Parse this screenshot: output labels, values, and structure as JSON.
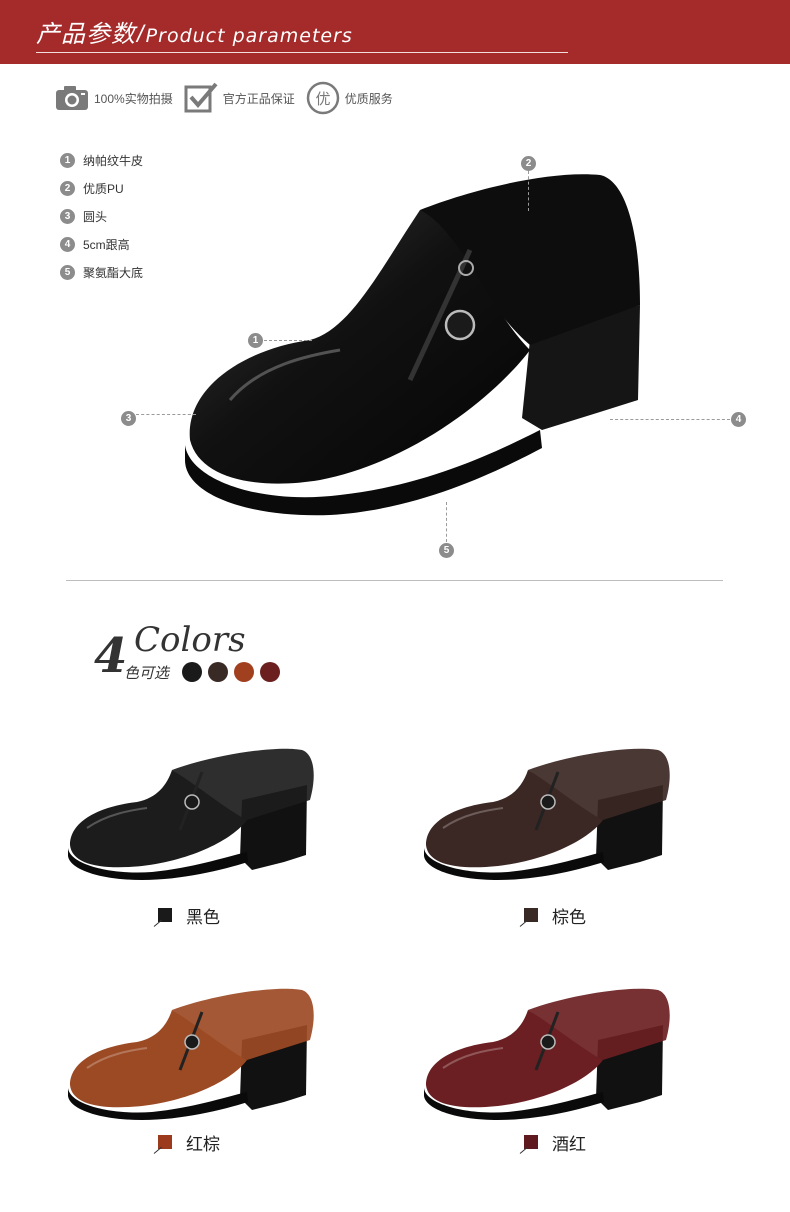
{
  "header": {
    "title_cn": "产品参数",
    "title_sep": "/",
    "title_en": "Product parameters"
  },
  "badges": [
    {
      "icon": "camera-icon",
      "label": "100%实物拍摄"
    },
    {
      "icon": "checkmark-icon",
      "label": "官方正品保证"
    },
    {
      "icon": "you-quality-icon",
      "icon_text": "优",
      "label": "优质服务"
    }
  ],
  "features": [
    {
      "num": "1",
      "label": "纳帕纹牛皮"
    },
    {
      "num": "2",
      "label": "优质PU"
    },
    {
      "num": "3",
      "label": "圆头"
    },
    {
      "num": "4",
      "label": "5cm跟高"
    },
    {
      "num": "5",
      "label": "聚氨酯大底"
    }
  ],
  "callouts": [
    "1",
    "2",
    "3",
    "4",
    "5"
  ],
  "colors_section": {
    "count": "4",
    "word": "Colors",
    "cn": "色可选",
    "swatches": [
      "#1a1a1a",
      "#3a2a26",
      "#a0401f",
      "#6b1f1f"
    ]
  },
  "variants": [
    {
      "name": "黑色",
      "color": "#1c1c1c",
      "square": "#1a1a1a"
    },
    {
      "name": "棕色",
      "color": "#3b2723",
      "square": "#3a2a26"
    },
    {
      "name": "红棕",
      "color": "#9c4a24",
      "square": "#9b3a1c"
    },
    {
      "name": "酒红",
      "color": "#6b1f22",
      "square": "#5e1a1e"
    }
  ]
}
